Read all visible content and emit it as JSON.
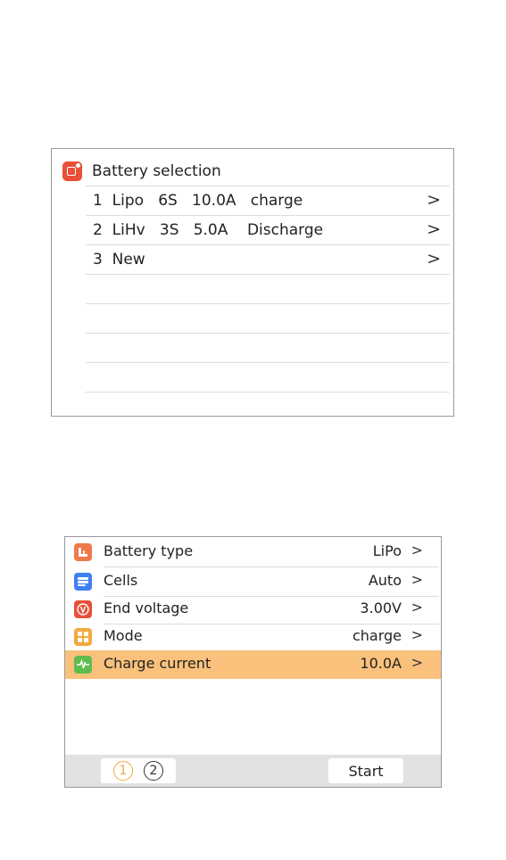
{
  "battery_selection": {
    "title": "Battery selection",
    "items": [
      {
        "text": "1  Lipo   6S   10.0A   charge",
        "chevron": ">"
      },
      {
        "text": "2  LiHv   3S   5.0A    Discharge",
        "chevron": ">"
      },
      {
        "text": "3  New",
        "chevron": ">"
      }
    ]
  },
  "settings": {
    "rows": [
      {
        "label": "Battery type",
        "value": "LiPo",
        "chevron": ">",
        "icon": "battery-type-icon",
        "color": "#f0794a"
      },
      {
        "label": "Cells",
        "value": "Auto",
        "chevron": ">",
        "icon": "cells-icon",
        "color": "#3f7ff0"
      },
      {
        "label": "End voltage",
        "value": "3.00V",
        "chevron": ">",
        "icon": "voltage-icon",
        "color": "#e8503a"
      },
      {
        "label": "Mode",
        "value": "charge",
        "chevron": ">",
        "icon": "mode-icon",
        "color": "#f3a940"
      },
      {
        "label": "Charge current",
        "value": "10.0A",
        "chevron": ">",
        "icon": "current-icon",
        "color": "#5fbd4f"
      }
    ],
    "selected_row_color": "#f9c17b"
  },
  "footer": {
    "pages": [
      "1",
      "2"
    ],
    "active_page": "1",
    "active_color": "#f3a940",
    "start_label": "Start"
  }
}
